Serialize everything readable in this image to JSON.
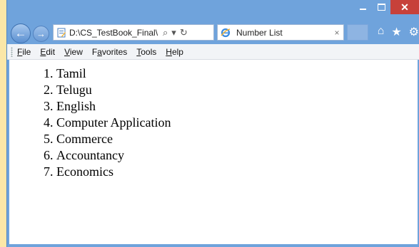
{
  "window": {
    "controls": {
      "minimize": "minimize-icon",
      "maximize": "maximize-icon",
      "close": "✕"
    }
  },
  "nav": {
    "back_glyph": "←",
    "forward_glyph": "→",
    "address": "D:\\CS_TestBook_Final\\",
    "search_glyph": "⌕",
    "dropdown_glyph": "▾",
    "refresh_glyph": "↻"
  },
  "tab": {
    "title": "Number List",
    "close_glyph": "×"
  },
  "toolbar": {
    "home_glyph": "⌂",
    "favorites_glyph": "★",
    "settings_glyph": "⚙"
  },
  "menu": {
    "items": [
      {
        "label": "File",
        "accel": "F",
        "rest": "ile"
      },
      {
        "label": "Edit",
        "accel": "E",
        "rest": "dit"
      },
      {
        "label": "View",
        "accel": "V",
        "rest": "iew"
      },
      {
        "label": "Favorites",
        "pre": "F",
        "accel": "a",
        "rest": "vorites"
      },
      {
        "label": "Tools",
        "accel": "T",
        "rest": "ools"
      },
      {
        "label": "Help",
        "accel": "H",
        "rest": "elp"
      }
    ]
  },
  "list": {
    "items": [
      "Tamil",
      "Telugu",
      "English",
      "Computer Application",
      "Commerce",
      "Accountancy",
      "Economics"
    ]
  },
  "colors": {
    "frame": "#6fa3dc",
    "close_button": "#c7413a",
    "outside": "#fbe7a8"
  }
}
